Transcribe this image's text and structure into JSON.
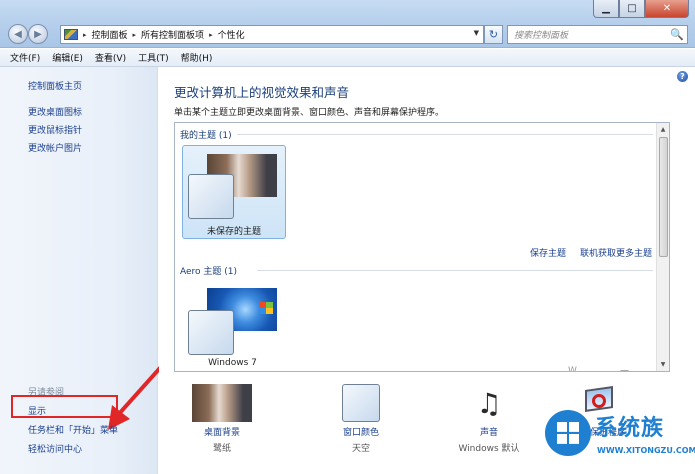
{
  "window": {
    "close_glyph": "✕",
    "min_glyph": "▁",
    "max_glyph": "□"
  },
  "nav": {
    "back_glyph": "◀",
    "forward_glyph": "▶",
    "refresh_glyph": "↻",
    "search_glyph": "🔍"
  },
  "address": {
    "breadcrumbs": [
      "控制面板",
      "所有控制面板项",
      "个性化"
    ],
    "separator": "▸"
  },
  "search": {
    "placeholder": "搜索控制面板"
  },
  "menubar": [
    "文件(F)",
    "编辑(E)",
    "查看(V)",
    "工具(T)",
    "帮助(H)"
  ],
  "sidebar": {
    "home": "控制面板主页",
    "links": [
      "更改桌面图标",
      "更改鼠标指针",
      "更改帐户图片"
    ],
    "see_also_label": "另请参阅",
    "see_also": [
      "显示",
      "任务栏和「开始」菜单",
      "轻松访问中心"
    ]
  },
  "main": {
    "help_glyph": "?",
    "title": "更改计算机上的视觉效果和声音",
    "subtitle": "单击某个主题立即更改桌面背景、窗口颜色、声音和屏幕保护程序。",
    "my_themes_label": "我的主题 (1)",
    "unsaved_theme": "未保存的主题",
    "save_theme": "保存主题",
    "get_more": "联机获取更多主题",
    "aero_label": "Aero 主题 (1)",
    "aero_themes": [
      "Windows 7"
    ],
    "trailing": [
      ".",
      "W",
      "—"
    ]
  },
  "bottom": [
    {
      "label": "桌面背景",
      "value": "鹭纸"
    },
    {
      "label": "窗口颜色",
      "value": "天空"
    },
    {
      "label": "声音",
      "value": "Windows 默认"
    },
    {
      "label": "屏幕保护程序",
      "value": ""
    }
  ],
  "watermark": {
    "title": "系统族",
    "url": "WWW.XITONGZU.COM"
  },
  "colors": {
    "accent": "#1b3f8f",
    "highlight": "#e02626",
    "watermark": "#1f7fd1"
  }
}
